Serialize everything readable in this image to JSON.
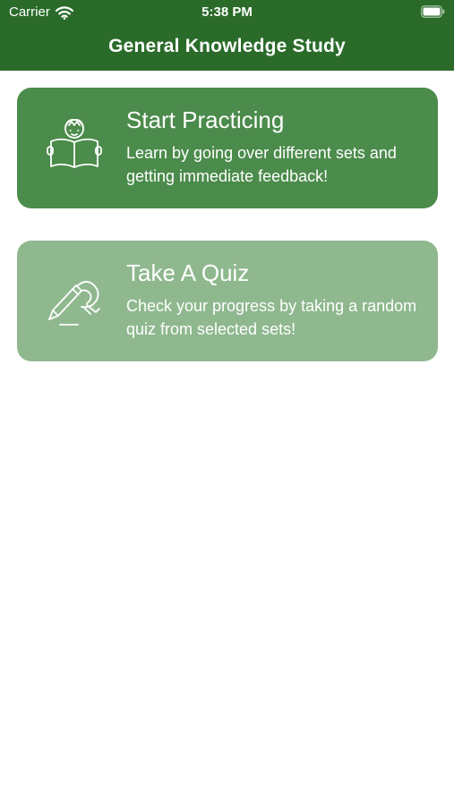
{
  "status_bar": {
    "carrier": "Carrier",
    "time": "5:38 PM",
    "icons": [
      "wifi-icon",
      "battery-icon"
    ]
  },
  "nav": {
    "title": "General Knowledge Study"
  },
  "cards": [
    {
      "title": "Start Practicing",
      "description": "Learn by going over different sets and getting immediate feedback!",
      "icon": "reading-person-icon"
    },
    {
      "title": "Take A Quiz",
      "description": "Check your progress by taking a random quiz from selected sets!",
      "icon": "writing-hand-icon"
    }
  ],
  "colors": {
    "header": "#2a6b2a",
    "card_practice": "#4b8b4b",
    "card_quiz": "#8fb88f",
    "text_on_color": "#ffffff",
    "background": "#ffffff"
  }
}
